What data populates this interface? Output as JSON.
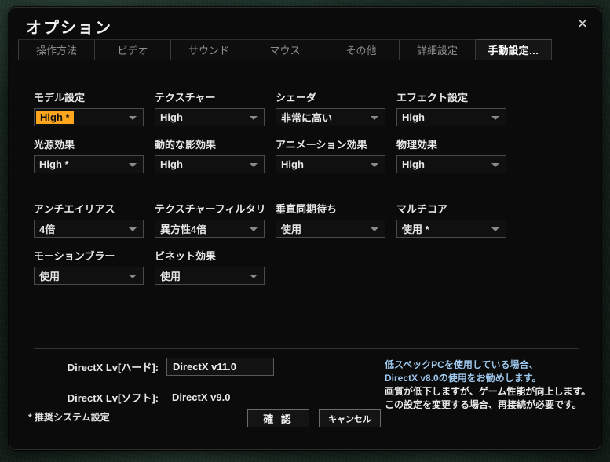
{
  "window": {
    "title": "オプション",
    "close_icon": "close-icon"
  },
  "tabs": [
    {
      "label": "操作方法",
      "active": false
    },
    {
      "label": "ビデオ",
      "active": false
    },
    {
      "label": "サウンド",
      "active": false
    },
    {
      "label": "マウス",
      "active": false
    },
    {
      "label": "その他",
      "active": false
    },
    {
      "label": "詳細設定",
      "active": false
    },
    {
      "label": "手動設定…",
      "active": true
    }
  ],
  "settings": {
    "row1": [
      {
        "label": "モデル設定",
        "value": "High *",
        "highlight": true
      },
      {
        "label": "テクスチャー",
        "value": "High",
        "highlight": false
      },
      {
        "label": "シェーダ",
        "value": "非常に高い",
        "highlight": false
      },
      {
        "label": "エフェクト設定",
        "value": "High",
        "highlight": false
      }
    ],
    "row2": [
      {
        "label": "光源効果",
        "value": "High *",
        "highlight": false
      },
      {
        "label": "動的な影効果",
        "value": "High",
        "highlight": false
      },
      {
        "label": "アニメーション効果",
        "value": "High",
        "highlight": false
      },
      {
        "label": "物理効果",
        "value": "High",
        "highlight": false
      }
    ],
    "row3": [
      {
        "label": "アンチエイリアス",
        "value": "4倍",
        "highlight": false
      },
      {
        "label": "テクスチャーフィルタリ",
        "value": "異方性4倍",
        "highlight": false
      },
      {
        "label": "垂直同期待ち",
        "value": "使用",
        "highlight": false
      },
      {
        "label": "マルチコア",
        "value": "使用 *",
        "highlight": false
      }
    ],
    "row4": [
      {
        "label": "モーションブラー",
        "value": "使用",
        "highlight": false
      },
      {
        "label": "ビネット効果",
        "value": "使用",
        "highlight": false
      }
    ]
  },
  "directx": {
    "hard_label": "DirectX Lv[ハード]:",
    "hard_value": "DirectX v11.0",
    "soft_label": "DirectX Lv[ソフト]:",
    "soft_value": "DirectX v9.0"
  },
  "info": {
    "line1": "低スペックPCを使用している場合、",
    "line2": "DirectX v8.0の使用をお勧めします。",
    "line3": "画質が低下しますが、ゲーム性能が向上します。",
    "line4": "この設定を変更する場合、再接続が必要です。"
  },
  "footnote": "* 推奨システム設定",
  "buttons": {
    "ok": "確 認",
    "cancel": "キャンセル"
  },
  "colors": {
    "highlight": "#ffa51e",
    "info_blue": "#9fc8ee",
    "dialog_bg": "#0b0b0b"
  }
}
